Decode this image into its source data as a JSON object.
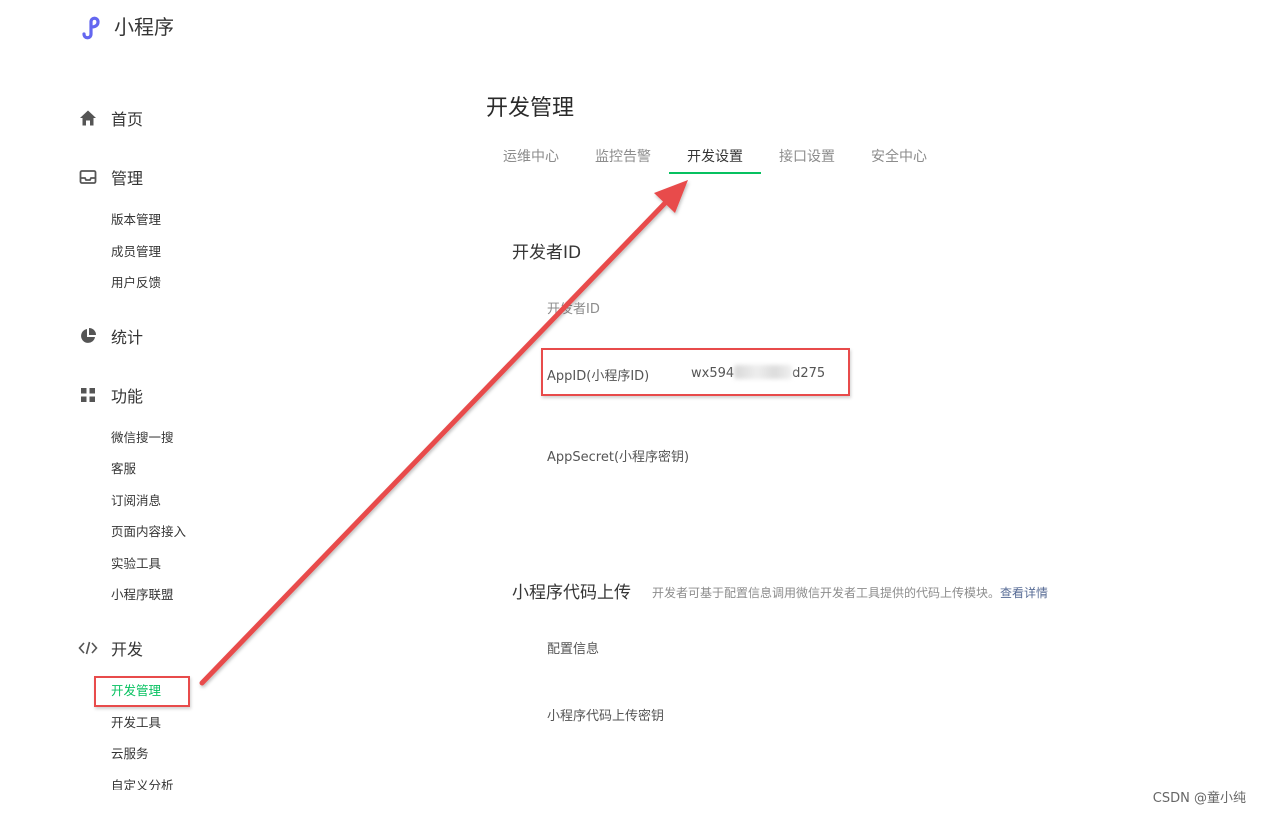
{
  "app": {
    "name": "小程序"
  },
  "sidebar": {
    "groups": [
      {
        "label": "首页",
        "icon": "home-icon"
      },
      {
        "label": "管理",
        "icon": "inbox-icon",
        "items": [
          "版本管理",
          "成员管理",
          "用户反馈"
        ]
      },
      {
        "label": "统计",
        "icon": "pie-chart-icon"
      },
      {
        "label": "功能",
        "icon": "grid-icon",
        "items": [
          "微信搜一搜",
          "客服",
          "订阅消息",
          "页面内容接入",
          "实验工具",
          "小程序联盟"
        ]
      },
      {
        "label": "开发",
        "icon": "code-icon",
        "items": [
          "开发管理",
          "开发工具",
          "云服务",
          "自定义分析"
        ]
      }
    ],
    "active_item": "开发管理"
  },
  "main": {
    "title": "开发管理",
    "tabs": [
      "运维中心",
      "监控告警",
      "开发设置",
      "接口设置",
      "安全中心"
    ],
    "active_tab": "开发设置",
    "developer_id": {
      "section_title": "开发者ID",
      "sub_label": "开发者ID",
      "appid_label": "AppID(小程序ID)",
      "appid_prefix": "wx594",
      "appid_suffix": "d275",
      "appsecret_label": "AppSecret(小程序密钥)"
    },
    "code_upload": {
      "section_title": "小程序代码上传",
      "description": "开发者可基于配置信息调用微信开发者工具提供的代码上传模块。",
      "link": "查看详情",
      "config_label": "配置信息",
      "key_label": "小程序代码上传密钥"
    }
  },
  "watermark": "CSDN @童小纯",
  "colors": {
    "accent": "#07c160",
    "annotation": "#e84b4b",
    "link": "#576b95",
    "logo": "#6467f0"
  }
}
